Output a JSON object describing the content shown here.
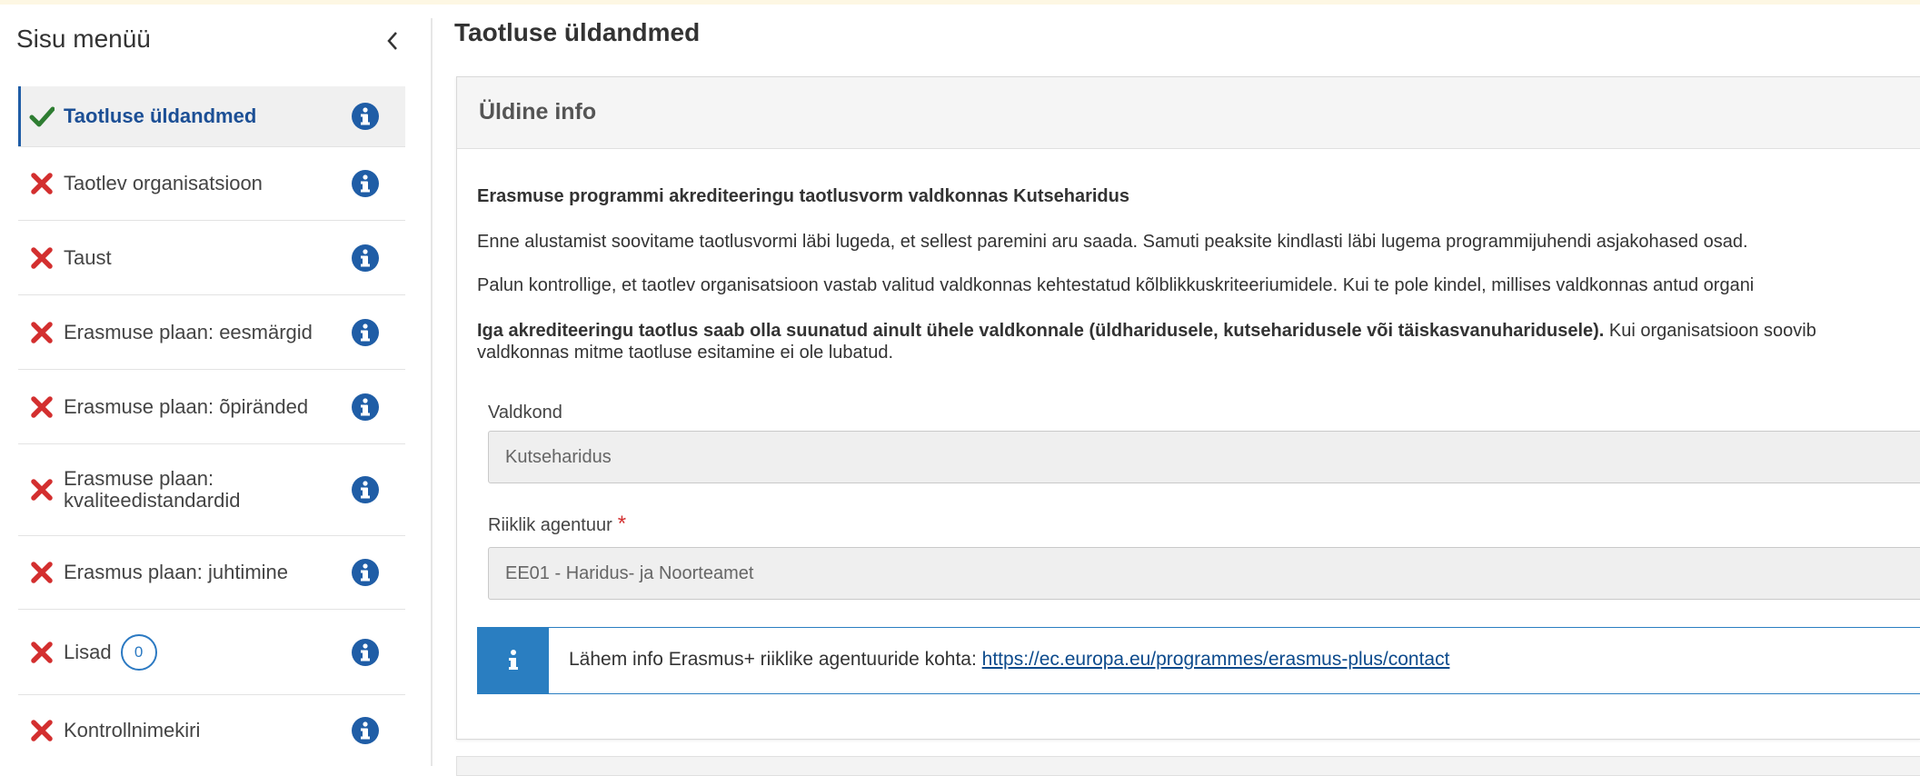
{
  "sidebar": {
    "title": "Sisu menüü",
    "items": [
      {
        "label": "Taotluse üldandmed",
        "status": "complete",
        "active": true
      },
      {
        "label": "Taotlev organisatsioon",
        "status": "incomplete"
      },
      {
        "label": "Taust",
        "status": "incomplete"
      },
      {
        "label": "Erasmuse plaan: eesmärgid",
        "status": "incomplete"
      },
      {
        "label": "Erasmuse plaan: õpiränded",
        "status": "incomplete"
      },
      {
        "label": "Erasmuse plaan: kvaliteedistandardid",
        "line1": "Erasmuse plaan:",
        "line2": "kvaliteedistandardid",
        "status": "incomplete"
      },
      {
        "label": "Erasmus plaan: juhtimine",
        "status": "incomplete"
      },
      {
        "label": "Lisad",
        "count": "0",
        "status": "incomplete"
      },
      {
        "label": "Kontrollnimekiri",
        "status": "incomplete"
      }
    ]
  },
  "main": {
    "title": "Taotluse üldandmed",
    "panel": {
      "header": "Üldine info",
      "heading": "Erasmuse programmi akrediteeringu taotlusvorm valdkonnas Kutseharidus",
      "p1": "Enne alustamist soovitame taotlusvormi läbi lugeda, et sellest paremini aru saada. Samuti peaksite kindlasti läbi lugema programmijuhendi asjakohased osad.",
      "p2": "Palun kontrollige, et taotlev organisatsioon vastab valitud valdkonnas kehtestatud kõlblikkuskriteeriumidele. Kui te pole kindel, millises valdkonnas antud organi",
      "p3_bold": "Iga akrediteeringu taotlus saab olla suunatud ainult ühele valdkonnale (üldharidusele, kutseharidusele või täiskasvanuharidusele).",
      "p3_rest": " Kui organisatsioon soovib",
      "p3_line2": "valdkonnas mitme taotluse esitamine ei ole lubatud.",
      "field1_label": "Valdkond",
      "field1_value": "Kutseharidus",
      "field2_label": "Riiklik agentuur",
      "field2_required": "*",
      "field2_value": "EE01 - Haridus- ja Noorteamet",
      "info_text": "Lähem info Erasmus+ riiklike agentuuride kohta: ",
      "info_link": "https://ec.europa.eu/programmes/erasmus-plus/contact"
    }
  },
  "colors": {
    "accent_blue": "#2a7ec1",
    "success_green": "#2e7d32",
    "error_red": "#d32f2f",
    "active_text": "#1c4f95"
  }
}
